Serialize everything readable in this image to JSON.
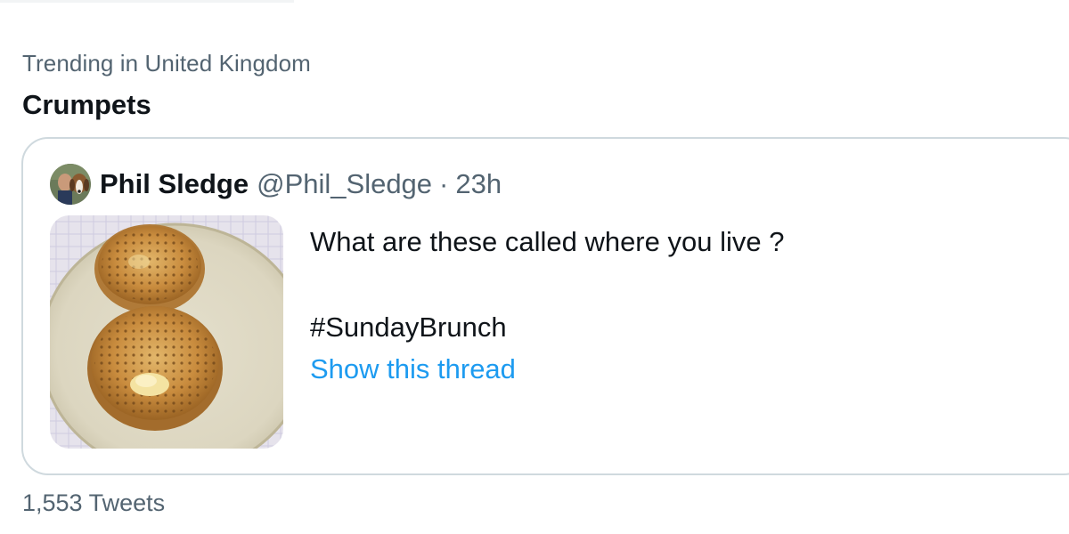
{
  "trend": {
    "context": "Trending in United Kingdom",
    "title": "Crumpets",
    "tweet_count": "1,553 Tweets"
  },
  "tweet": {
    "author_name": "Phil Sledge",
    "author_handle": "@Phil_Sledge",
    "separator": "·",
    "time": "23h",
    "text_line_1": "What are these called where you live ?",
    "text_line_2": "#SundayBrunch",
    "show_thread": "Show this thread"
  },
  "colors": {
    "primary_text": "#0f1419",
    "secondary_text": "#536471",
    "link_blue": "#1d9bf0",
    "border": "#cfd9de"
  },
  "icons": {
    "avatar": "avatar-photo",
    "media": "crumpets-photo"
  }
}
